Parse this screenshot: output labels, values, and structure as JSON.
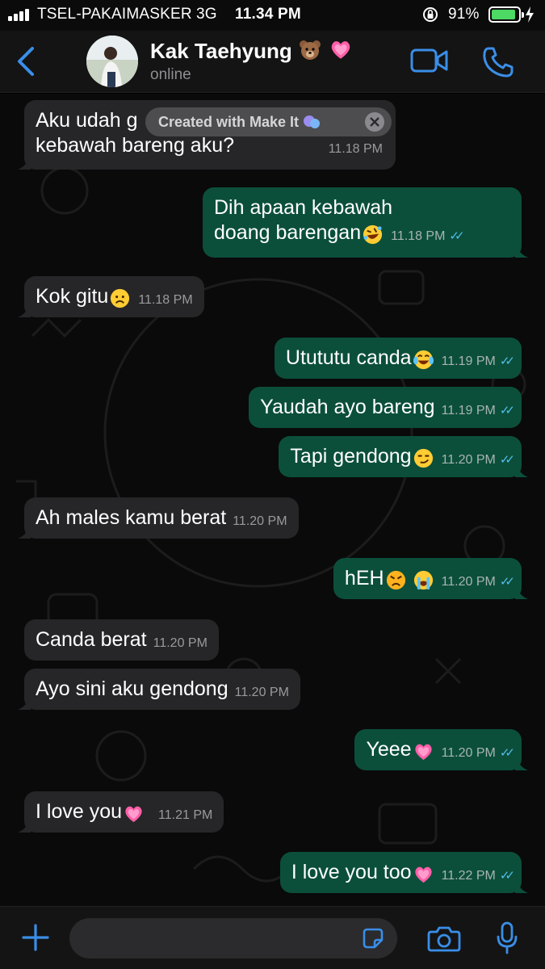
{
  "status_bar": {
    "carrier": "TSEL-PAKAIMASKER",
    "network": "3G",
    "time": "11.34 PM",
    "battery_percent": "91%",
    "battery_level": 0.91,
    "battery_color": "#4cd964"
  },
  "header": {
    "contact_name": "Kak Taehyung",
    "name_emojis": [
      "bear-emoji",
      "pink-heart-emoji"
    ],
    "status": "online",
    "accent_color": "#3a8ee8"
  },
  "watermark": {
    "text": "Created with Make It",
    "icon": "bubble-icon"
  },
  "messages": [
    {
      "dir": "in",
      "text": "Aku udah g",
      "text_line2": "kebawah bareng aku?",
      "time": "11.18 PM"
    },
    {
      "dir": "out",
      "text": "Dih apaan kebawah",
      "text_line2": "doang barengan",
      "emoji": "rofl-emoji",
      "time": "11.18 PM"
    },
    {
      "dir": "in",
      "text": "Kok gitu",
      "emoji": "frown-emoji",
      "time": "11.18 PM"
    },
    {
      "dir": "out",
      "text": "Utututu canda",
      "emoji": "tears-of-joy-emoji",
      "time": "11.19 PM"
    },
    {
      "dir": "out",
      "text": "Yaudah ayo bareng",
      "time": "11.19 PM"
    },
    {
      "dir": "out",
      "text": "Tapi gendong",
      "emoji": "smirk-emoji",
      "time": "11.20 PM"
    },
    {
      "dir": "in",
      "text": "Ah males kamu berat",
      "time": "11.20 PM"
    },
    {
      "dir": "out",
      "text": "hEH",
      "emoji": "angry-emoji",
      "emoji2": "crying-emoji",
      "time": "11.20 PM"
    },
    {
      "dir": "in",
      "text": "Canda berat",
      "time": "11.20 PM"
    },
    {
      "dir": "in",
      "text": "Ayo sini aku gendong",
      "time": "11.20 PM"
    },
    {
      "dir": "out",
      "text": "Yeee",
      "emoji": "pink-heart-emoji",
      "time": "11.20 PM"
    },
    {
      "dir": "in",
      "text": "I love you",
      "emoji": "pink-heart-emoji",
      "time": "11.21 PM"
    },
    {
      "dir": "out",
      "text": "I love you too",
      "emoji": "pink-heart-emoji",
      "time": "11.22 PM"
    }
  ],
  "colors": {
    "outgoing_bubble": "#0b4f3b",
    "incoming_bubble": "#262628",
    "read_ticks": "#53bdeb"
  },
  "input": {
    "value": ""
  }
}
